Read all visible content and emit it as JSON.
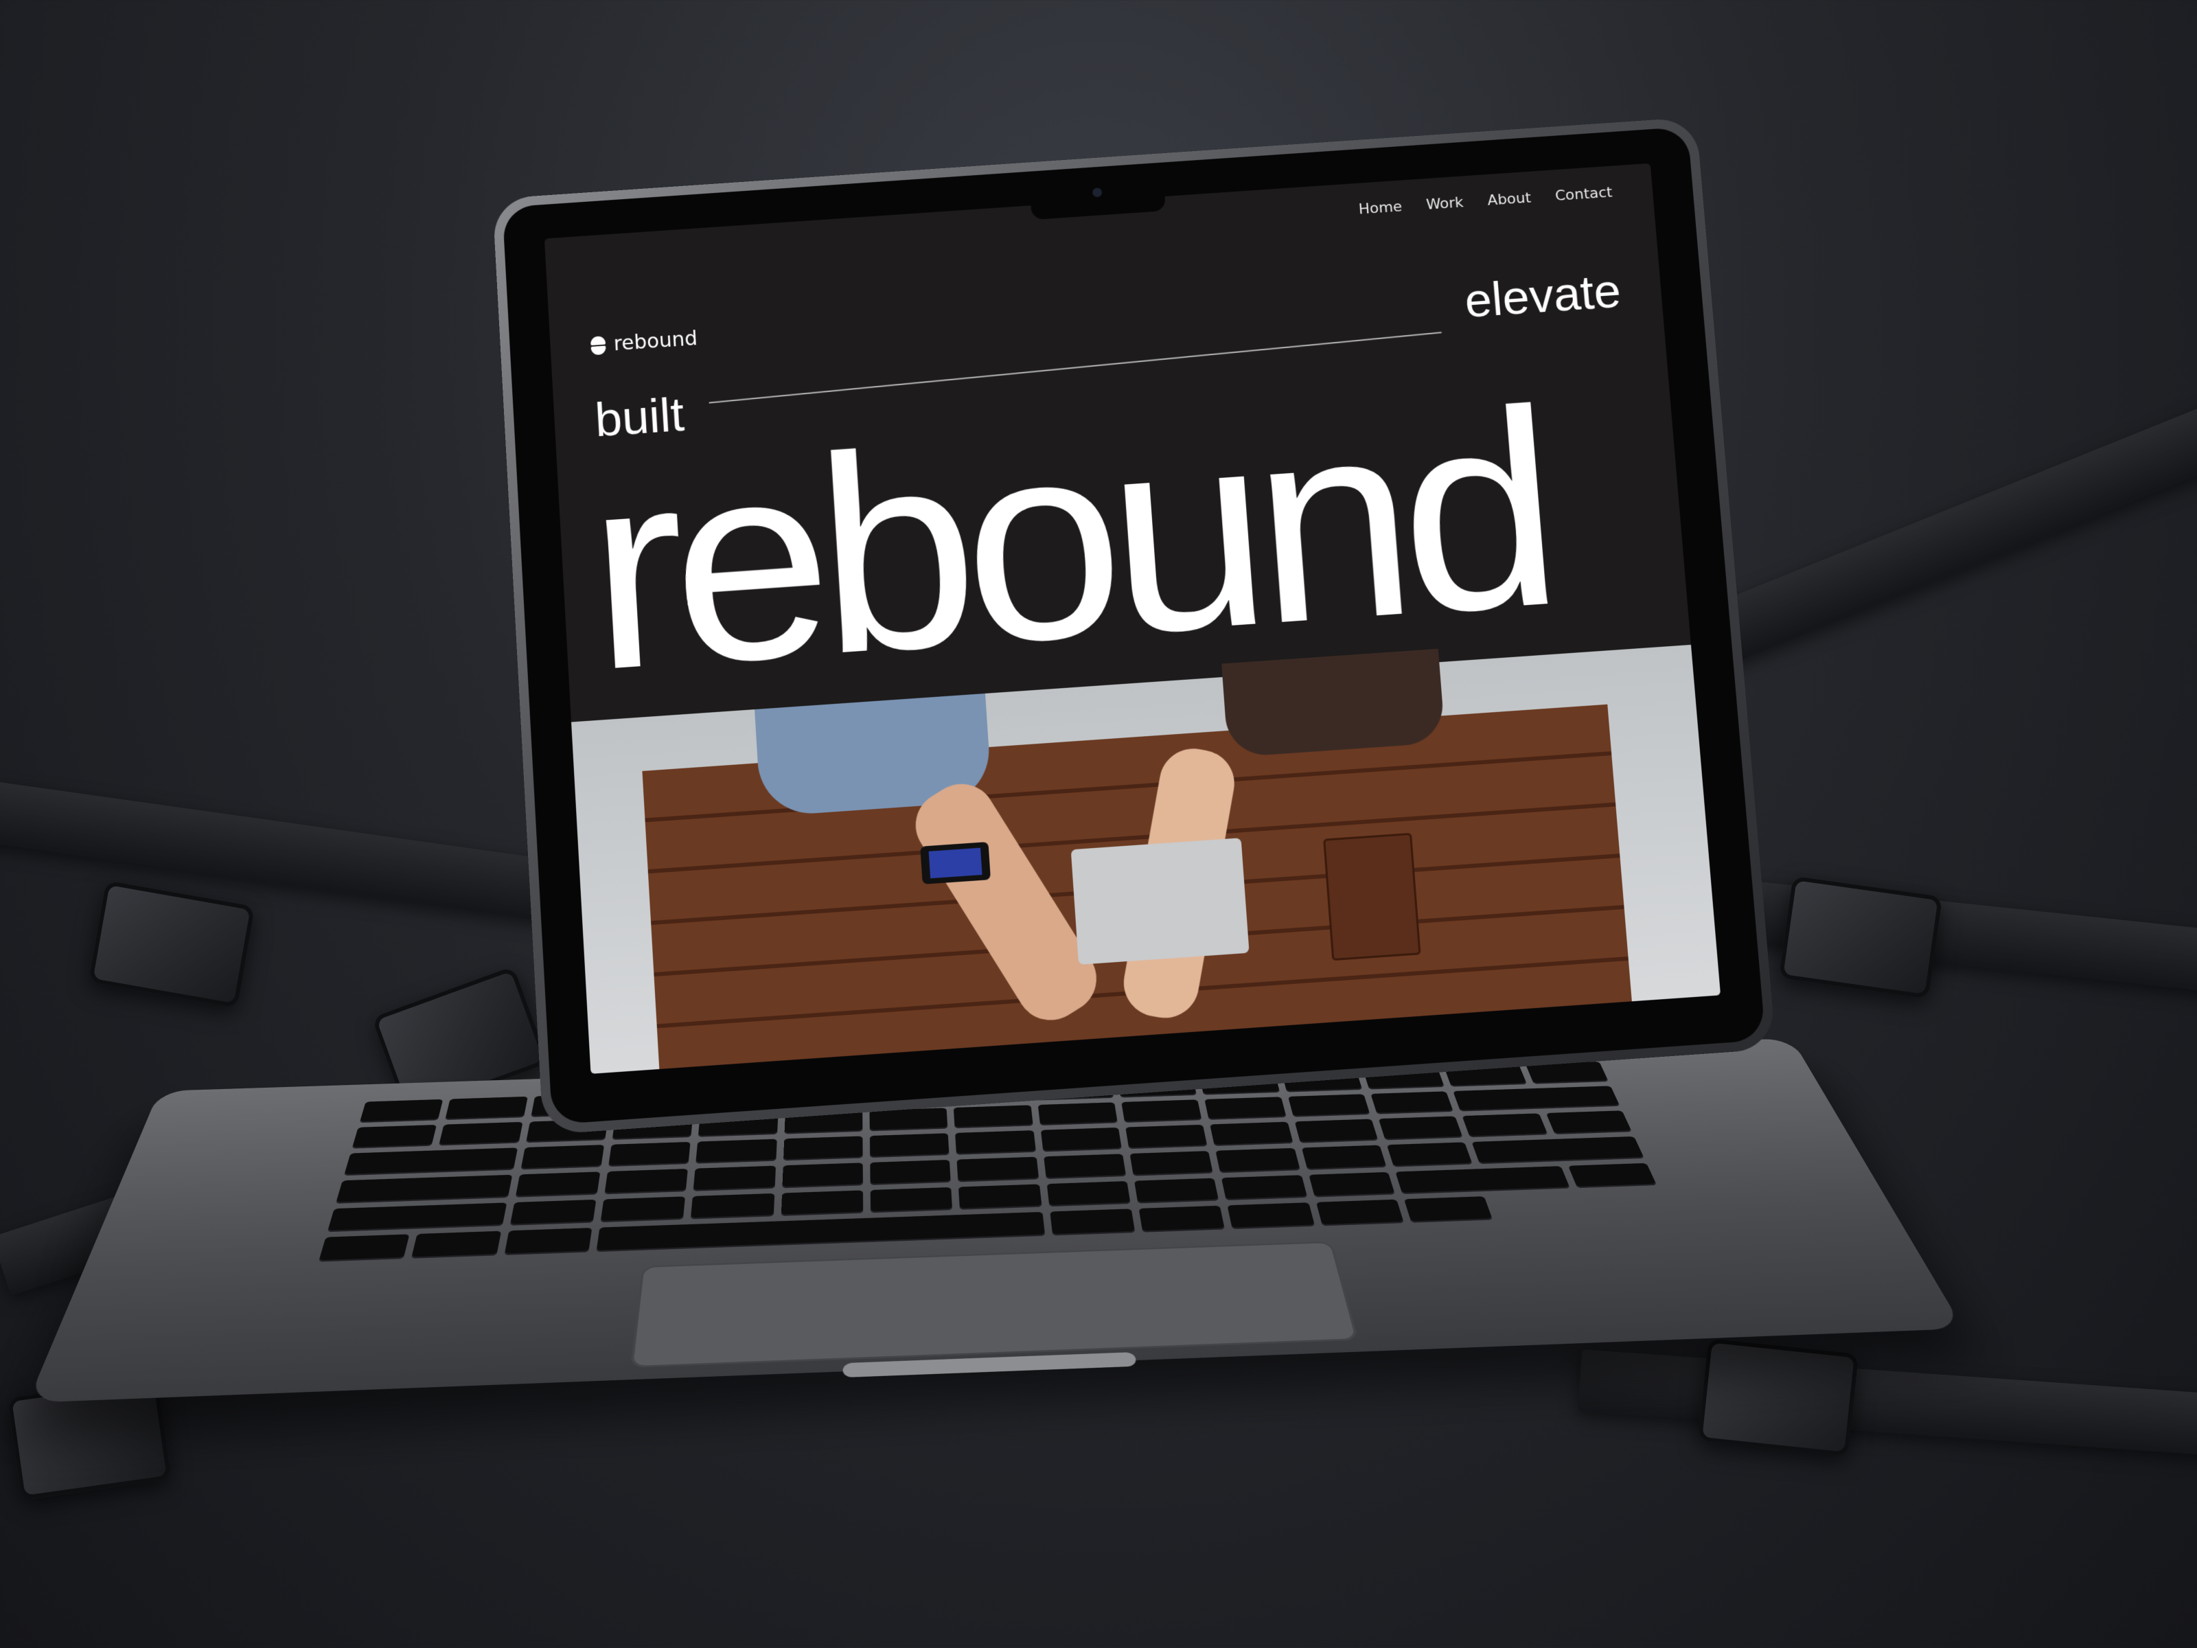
{
  "site": {
    "brand": "rebound",
    "nav": [
      "Home",
      "Work",
      "About",
      "Contact"
    ],
    "word_left": "built",
    "word_right": "elevate",
    "hero_word": "rebound"
  },
  "icons": {
    "logo": "rebound-logo-icon",
    "camera": "camera-icon"
  },
  "colors": {
    "background": "#25272c",
    "screen_bg": "#1d1b1b",
    "text": "#ffffff"
  }
}
